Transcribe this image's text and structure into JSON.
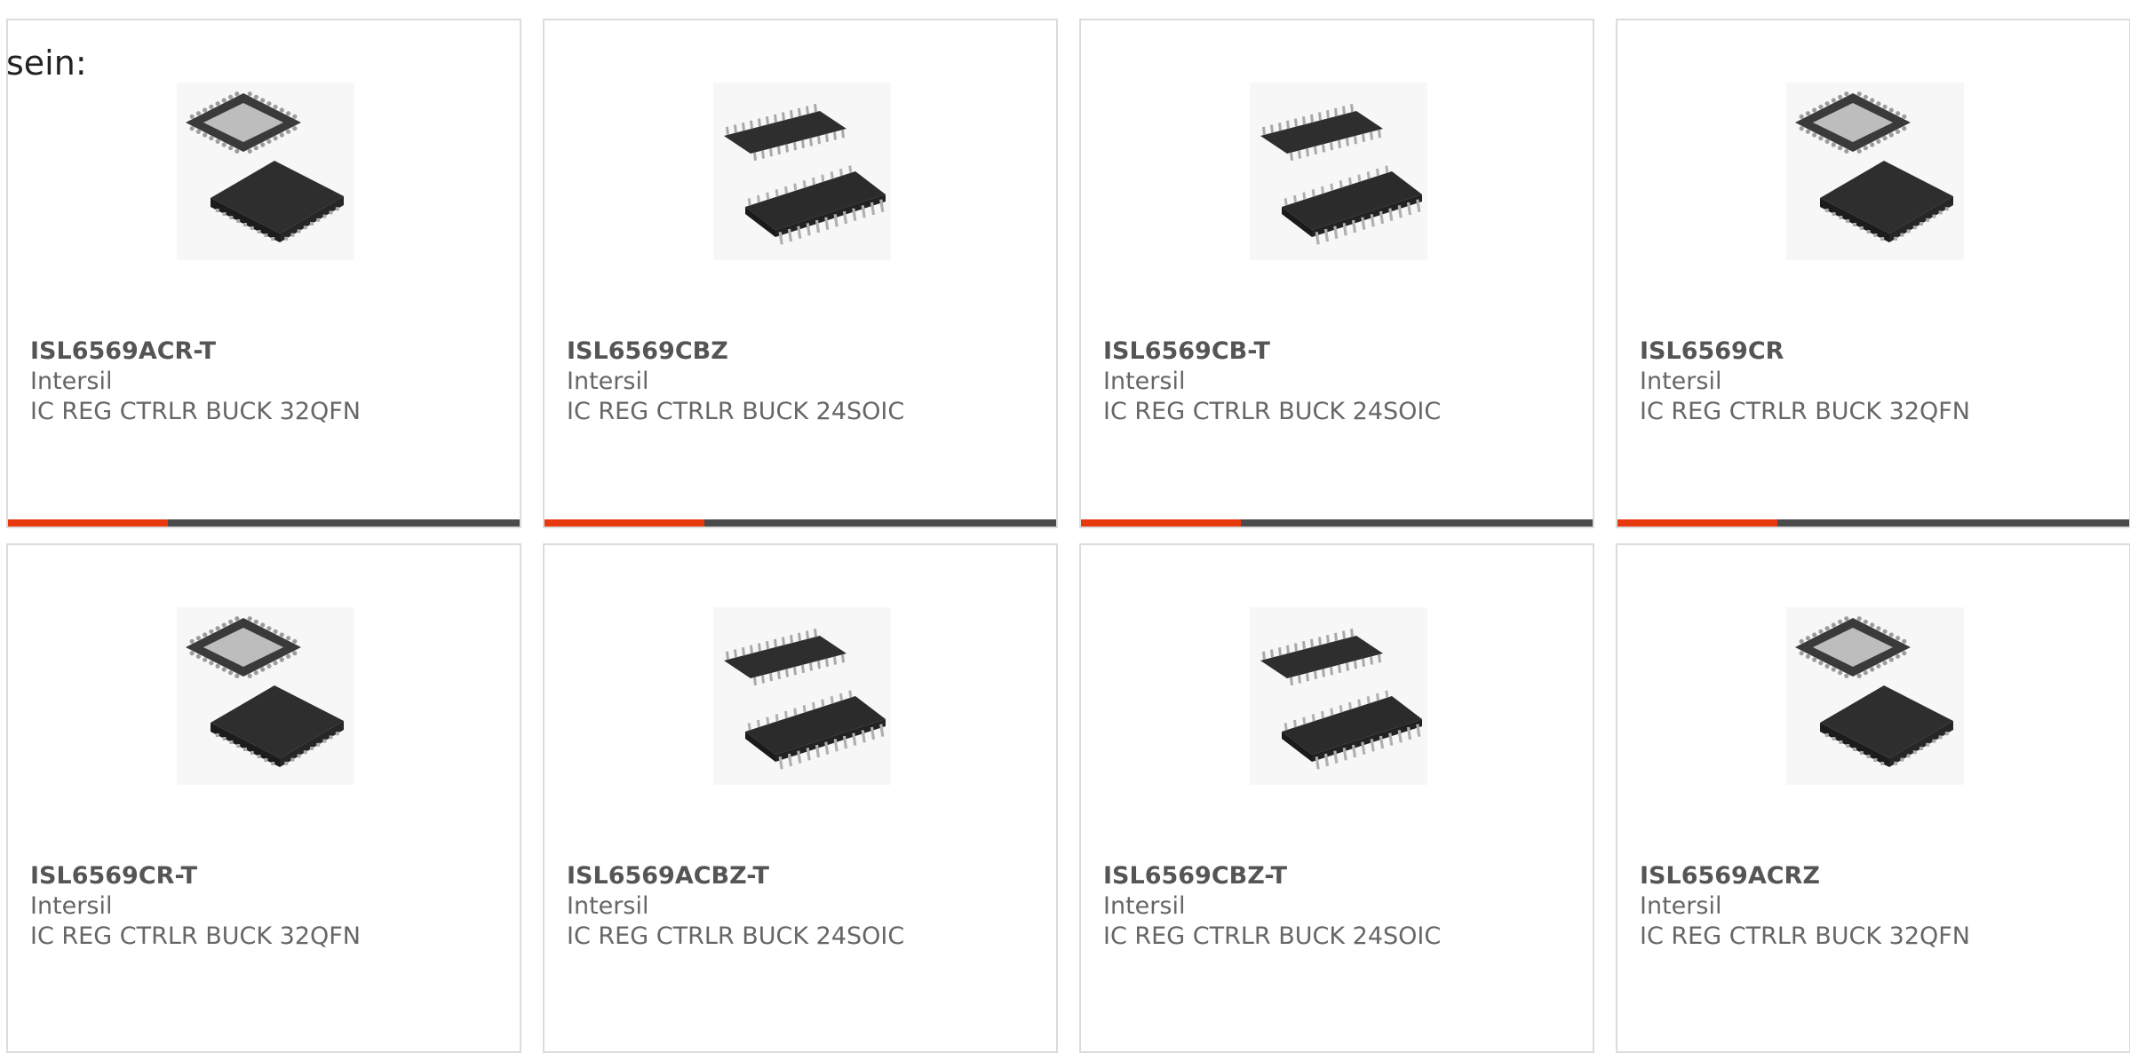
{
  "intro_text": "sein:",
  "colors": {
    "accent": "#e8390e",
    "bar": "#4a4a4a",
    "border": "#dcdcdc"
  },
  "products": [
    {
      "part": "ISL6569ACR-T",
      "maker": "Intersil",
      "desc": "IC REG CTRLR BUCK 32QFN",
      "icon": "qfn-chip-icon"
    },
    {
      "part": "ISL6569CBZ",
      "maker": "Intersil",
      "desc": "IC REG CTRLR BUCK 24SOIC",
      "icon": "soic-chip-icon"
    },
    {
      "part": "ISL6569CB-T",
      "maker": "Intersil",
      "desc": "IC REG CTRLR BUCK 24SOIC",
      "icon": "soic-chip-icon"
    },
    {
      "part": "ISL6569CR",
      "maker": "Intersil",
      "desc": "IC REG CTRLR BUCK 32QFN",
      "icon": "qfn-chip-icon"
    },
    {
      "part": "ISL6569CR-T",
      "maker": "Intersil",
      "desc": "IC REG CTRLR BUCK 32QFN",
      "icon": "qfn-chip-icon"
    },
    {
      "part": "ISL6569ACBZ-T",
      "maker": "Intersil",
      "desc": "IC REG CTRLR BUCK 24SOIC",
      "icon": "soic-chip-icon"
    },
    {
      "part": "ISL6569CBZ-T",
      "maker": "Intersil",
      "desc": "IC REG CTRLR BUCK 24SOIC",
      "icon": "soic-chip-icon"
    },
    {
      "part": "ISL6569ACRZ",
      "maker": "Intersil",
      "desc": "IC REG CTRLR BUCK 32QFN",
      "icon": "qfn-chip-icon"
    }
  ]
}
